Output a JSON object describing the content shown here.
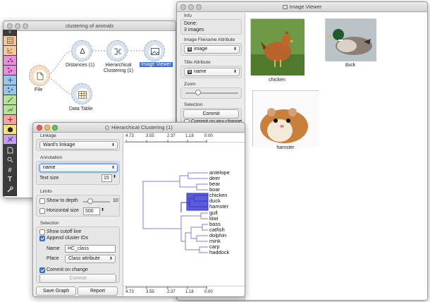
{
  "canvas": {
    "title": "clustering of animals",
    "nodes": {
      "file": "File",
      "distances": "Distances (1)",
      "hier": "Hierarchical\nClustering (1)",
      "viewer": "Image Viewer",
      "table": "Data Table"
    }
  },
  "toolbox": {
    "colors": [
      "#f5c9a0",
      "#f5c9a0",
      "#e78fdc",
      "#e78fdc",
      "#97c6ea",
      "#97c6ea",
      "#b7e09a",
      "#b7e09a",
      "#f5a3a3",
      "#f5e27a",
      "#c49ff0"
    ]
  },
  "viewer": {
    "title": "Image Viewer",
    "info_title": "Info",
    "info_line1": "Done:",
    "info_line2": "3 images",
    "filename_title": "Image Filename Attribute",
    "filename_value": "image",
    "title_attr_title": "Title Attribute",
    "title_attr_value": "name",
    "zoom_title": "Zoom",
    "selection_title": "Selection",
    "commit": "Commit",
    "commit_on_change": "Commit on any change",
    "images": [
      {
        "label": "chicken"
      },
      {
        "label": "duck"
      },
      {
        "label": "hamster"
      }
    ]
  },
  "hc": {
    "title": "Hierarchical Clustering (1)",
    "linkage_title": "Linkage",
    "linkage_value": "Ward's linkage",
    "annotation_title": "Annotation",
    "annotation_value": "name",
    "text_size_label": "Text size",
    "text_size_value": "15",
    "limits_title": "Limits",
    "show_depth": "Show to depth",
    "depth_value": "10",
    "horizontal_size": "Horizontal size",
    "horizontal_value": "500",
    "selection_title": "Selection",
    "show_cutoff": "Show cutoff line",
    "append_ids": "Append cluster IDs",
    "name_label": "Name",
    "name_value": "HC_class",
    "place_label": "Place",
    "place_value": "Class attribute",
    "commit_on_change": "Commit on change",
    "commit": "Commit",
    "save_graph": "Save Graph",
    "report": "Report",
    "axis_ticks": [
      "4.73",
      "3.55",
      "2.37",
      "1.18",
      "0.00"
    ],
    "leaves": [
      "antelope",
      "deer",
      "bear",
      "boar",
      "chicken",
      "duck",
      "hamster",
      "gull",
      "kiwi",
      "bass",
      "catfish",
      "dolphin",
      "mink",
      "carp",
      "haddock"
    ]
  }
}
